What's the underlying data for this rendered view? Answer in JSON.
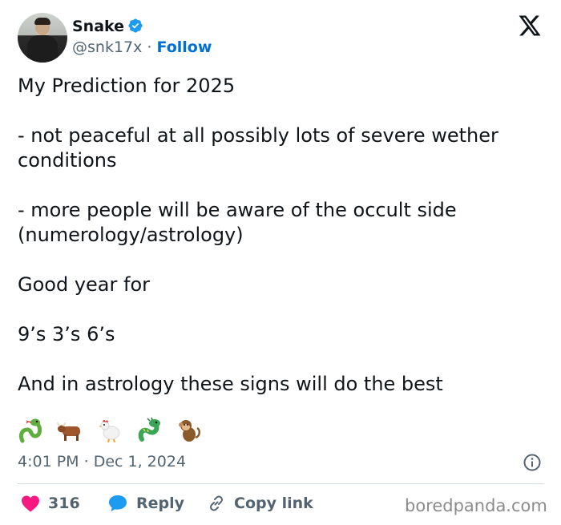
{
  "author": {
    "name": "Snake",
    "handle": "@snk17x",
    "separator": "·",
    "follow_label": "Follow",
    "verified": true
  },
  "tweet": {
    "lines": [
      "My Prediction for 2025",
      "- not peaceful at all possibly lots of severe wether conditions",
      "- more people will be aware of the occult side (numerology/astrology)",
      "Good year for",
      "9’s 3’s 6’s",
      "And in astrology these signs will do the best"
    ],
    "emojis": [
      "snake-emoji",
      "ox-emoji",
      "rooster-emoji",
      "dragon-emoji",
      "monkey-emoji"
    ]
  },
  "meta": {
    "time": "4:01 PM",
    "separator": "·",
    "date": "Dec 1, 2024"
  },
  "actions": {
    "likes": "316",
    "reply_label": "Reply",
    "copy_label": "Copy link"
  },
  "watermark": "boredpanda.com",
  "colors": {
    "text": "#0f1419",
    "secondary": "#536471",
    "link": "#006fd6",
    "like": "#f91880",
    "reply": "#1d9bf0",
    "divider": "#cfd9de"
  }
}
